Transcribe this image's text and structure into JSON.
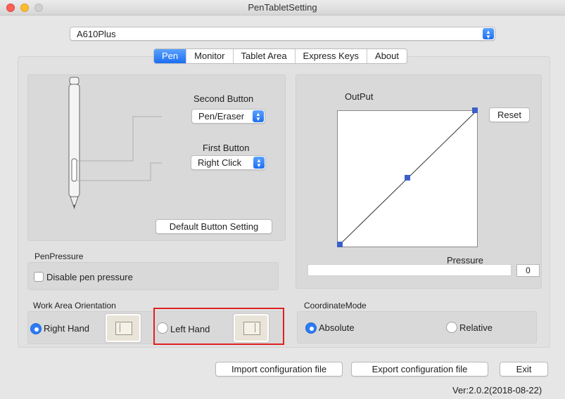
{
  "window": {
    "title": "PenTabletSetting"
  },
  "device": {
    "selected": "A610Plus"
  },
  "tabs": [
    {
      "label": "Pen",
      "active": true
    },
    {
      "label": "Monitor",
      "active": false
    },
    {
      "label": "Tablet Area",
      "active": false
    },
    {
      "label": "Express Keys",
      "active": false
    },
    {
      "label": "About",
      "active": false
    }
  ],
  "pen": {
    "second_button": {
      "label": "Second Button",
      "value": "Pen/Eraser"
    },
    "first_button": {
      "label": "First Button",
      "value": "Right Click"
    },
    "default_button": "Default  Button Setting"
  },
  "output": {
    "label": "OutPut",
    "reset": "Reset",
    "pressure_label": "Pressure",
    "pressure_value": "0"
  },
  "pen_pressure": {
    "title": "PenPressure",
    "disable_label": "Disable pen pressure",
    "disabled": false
  },
  "orientation": {
    "title": "Work Area Orientation",
    "right_hand": "Right Hand",
    "left_hand": "Left Hand",
    "selected": "Right Hand"
  },
  "coordinate": {
    "title": "CoordinateMode",
    "absolute": "Absolute",
    "relative": "Relative",
    "selected": "Absolute"
  },
  "footer": {
    "import": "Import configuration file",
    "export": "Export configuration file",
    "exit": "Exit",
    "version": "Ver:2.0.2(2018-08-22)"
  },
  "icons": {
    "window_close": "close-dot-icon",
    "window_minimize": "minimize-dot-icon",
    "window_zoom": "zoom-dot-icon",
    "pen": "stylus-pen-icon",
    "dropdown": "updown-chevron-icon",
    "handedness_thumb": "tablet-orientation-icon"
  },
  "colors": {
    "accent": "#2d7cf6",
    "highlight": "#e02020",
    "graph_point": "#3b5fc9"
  }
}
